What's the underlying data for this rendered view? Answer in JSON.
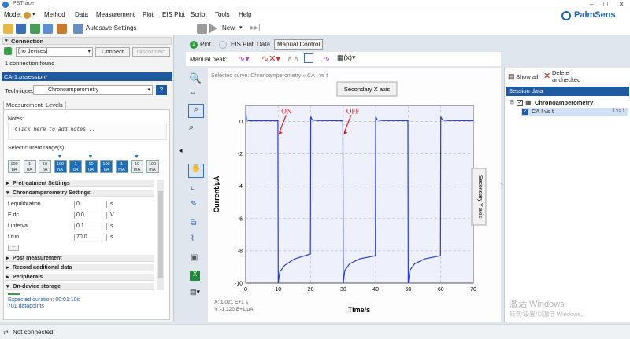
{
  "window": {
    "title": "PSTrace",
    "controls": [
      "–",
      "☐",
      "✕"
    ]
  },
  "menubar": {
    "mode_label": "Mode:",
    "items": [
      "Method",
      "Data",
      "Measurement",
      "Plot",
      "EIS Plot",
      "Script",
      "Tools",
      "Help"
    ],
    "brand": "PalmSens"
  },
  "toolbar": {
    "autosave": "Autosave Settings",
    "new_label": "New"
  },
  "connection": {
    "title": "Connection",
    "device": "[no devices]",
    "connect": "Connect",
    "disconnect": "Disconnect",
    "found": "1 connection found"
  },
  "session": {
    "file": "CA-1.pssession*",
    "technique_label": "Technique:",
    "technique": "Chronoamperometry",
    "help": "?"
  },
  "method_tabs": [
    "Measurement",
    "Levels"
  ],
  "notes": {
    "label": "Notes:",
    "placeholder": "Click here to add notes..."
  },
  "current_range": {
    "label": "Select current range(s):",
    "buttons": [
      {
        "v": "100",
        "u": "pA",
        "sel": false
      },
      {
        "v": "1",
        "u": "nA",
        "sel": false
      },
      {
        "v": "10",
        "u": "nA",
        "sel": false
      },
      {
        "v": "100",
        "u": "nA",
        "sel": true
      },
      {
        "v": "1",
        "u": "uA",
        "sel": true
      },
      {
        "v": "10",
        "u": "uA",
        "sel": true
      },
      {
        "v": "100",
        "u": "uA",
        "sel": true
      },
      {
        "v": "1",
        "u": "mA",
        "sel": true
      },
      {
        "v": "10",
        "u": "mA",
        "sel": false
      },
      {
        "v": "100",
        "u": "mA",
        "sel": false
      }
    ]
  },
  "sections": {
    "pretreatment": "Pretreatment Settings",
    "chrono": "Chronoamperometry Settings",
    "post": "Post measurement",
    "record": "Record additional data",
    "peripherals": "Peripherals",
    "ondevice": "On-device storage"
  },
  "params": [
    {
      "label": "t equilibration",
      "value": "0",
      "unit": "s"
    },
    {
      "label": "E dc",
      "value": "0.0",
      "unit": "V"
    },
    {
      "label": "t interval",
      "value": "0.1",
      "unit": "s"
    },
    {
      "label": "t run",
      "value": "70.0",
      "unit": "s"
    }
  ],
  "more": "···",
  "expected": "Expected duration: 00:01:10s",
  "datapoints": "701 datapoints",
  "plot_tabs": [
    "Plot",
    "EIS Plot",
    "Data",
    "Manual Control"
  ],
  "plot_toolbar": {
    "manual_peak": "Manual peak:"
  },
  "plot": {
    "selected_curve": "Selected curve: Chronoamperometry » CA I vs t",
    "secondary_x": "Secondary X axis",
    "secondary_y": "Secondary Y axis",
    "annotations": [
      "ON",
      "OFF"
    ],
    "cursor_x": "X: 1.021 E+1 s",
    "cursor_y": "Y: -1.120 E+1 µA"
  },
  "chart_data": {
    "type": "line",
    "xlabel": "Time/s",
    "ylabel": "Current/µA",
    "xlim": [
      0,
      70
    ],
    "ylim": [
      -10,
      1
    ],
    "xticks": [
      0,
      10,
      20,
      30,
      40,
      50,
      60,
      70
    ],
    "yticks": [
      0,
      -2,
      -4,
      -6,
      -8,
      -10
    ],
    "grid": true,
    "series": [
      {
        "name": "CA I vs t",
        "points": [
          [
            0,
            0.6
          ],
          [
            0.3,
            0.1
          ],
          [
            1,
            0.05
          ],
          [
            9.9,
            0.05
          ],
          [
            10,
            -10
          ],
          [
            10.5,
            -9.3
          ],
          [
            12,
            -8.9
          ],
          [
            15,
            -8.5
          ],
          [
            19.9,
            -8.2
          ],
          [
            20,
            0.3
          ],
          [
            20.5,
            0.1
          ],
          [
            22,
            0.06
          ],
          [
            29.9,
            0.05
          ],
          [
            30,
            -10
          ],
          [
            30.5,
            -9.2
          ],
          [
            32,
            -8.8
          ],
          [
            35,
            -8.5
          ],
          [
            39.9,
            -8.3
          ],
          [
            40,
            0.3
          ],
          [
            40.5,
            0.1
          ],
          [
            42,
            0.06
          ],
          [
            49.9,
            0.05
          ],
          [
            50,
            -10
          ],
          [
            50.5,
            -9.2
          ],
          [
            52,
            -8.8
          ],
          [
            55,
            -8.5
          ],
          [
            59.9,
            -8.3
          ],
          [
            60,
            0.3
          ],
          [
            60.5,
            0.1
          ],
          [
            62,
            0.06
          ],
          [
            70,
            0.05
          ]
        ]
      }
    ]
  },
  "right_panel": {
    "show_all": "Show all",
    "delete_unchecked": "Delete\nunchecked",
    "session_title": "Session data",
    "tree_root": "Chronoamperometry",
    "curve": "CA I vs t",
    "curve_unit": "I vs t"
  },
  "watermark": {
    "line1": "激活 Windows",
    "line2": "转到\"设置\"以激活 Windows。"
  },
  "status": {
    "text": "Not connected"
  },
  "colors": {
    "accent": "#1f5aa0",
    "curve": "#2b3fd6",
    "annotation": "#d62020",
    "plot_bg": "#eef0fb"
  }
}
